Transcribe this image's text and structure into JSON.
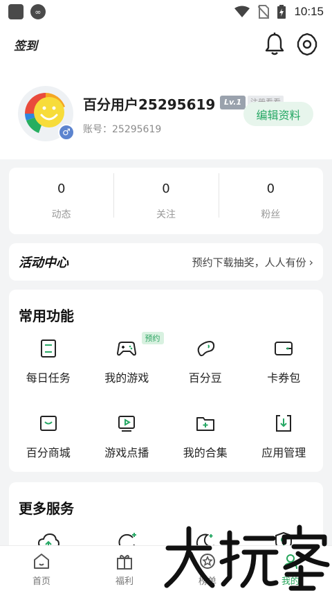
{
  "status_bar": {
    "time": "10:15",
    "left_icons": [
      "square-icon",
      "infinity-icon"
    ],
    "right_icons": [
      "wifi-icon",
      "no-sim-icon",
      "battery-icon"
    ]
  },
  "header": {
    "signin_label": "签到",
    "icons": [
      "bell-icon",
      "settings-icon"
    ]
  },
  "profile": {
    "username": "百分用户25295619",
    "level": "Lv.1",
    "register_hint": "注册看看",
    "edit_label": "编辑资料",
    "account": "账号：25295619",
    "gender_symbol": "♂"
  },
  "stats": [
    {
      "value": "0",
      "label": "动态"
    },
    {
      "value": "0",
      "label": "关注"
    },
    {
      "value": "0",
      "label": "粉丝"
    }
  ],
  "activity": {
    "title": "活动中心",
    "text": "预约下载抽奖，人人有份"
  },
  "features": {
    "title": "常用功能",
    "items": [
      {
        "label": "每日任务",
        "icon": "task-icon"
      },
      {
        "label": "我的游戏",
        "icon": "gamepad-icon",
        "badge": "预约"
      },
      {
        "label": "百分豆",
        "icon": "bean-icon"
      },
      {
        "label": "卡券包",
        "icon": "wallet-icon"
      },
      {
        "label": "百分商城",
        "icon": "mall-icon"
      },
      {
        "label": "游戏点播",
        "icon": "play-icon"
      },
      {
        "label": "我的合集",
        "icon": "collection-folder-icon"
      },
      {
        "label": "应用管理",
        "icon": "download-manage-icon"
      }
    ]
  },
  "more_services": {
    "title": "更多服务"
  },
  "bottom_nav": [
    {
      "label": "首页",
      "icon": "home-icon"
    },
    {
      "label": "福利",
      "icon": "gift-icon"
    },
    {
      "label": "榜单",
      "icon": "rank-icon"
    },
    {
      "label": "我的",
      "icon": "me-icon"
    }
  ],
  "colors": {
    "accent": "#27a865",
    "background": "#f3f4f5"
  },
  "watermark": "大玩家"
}
